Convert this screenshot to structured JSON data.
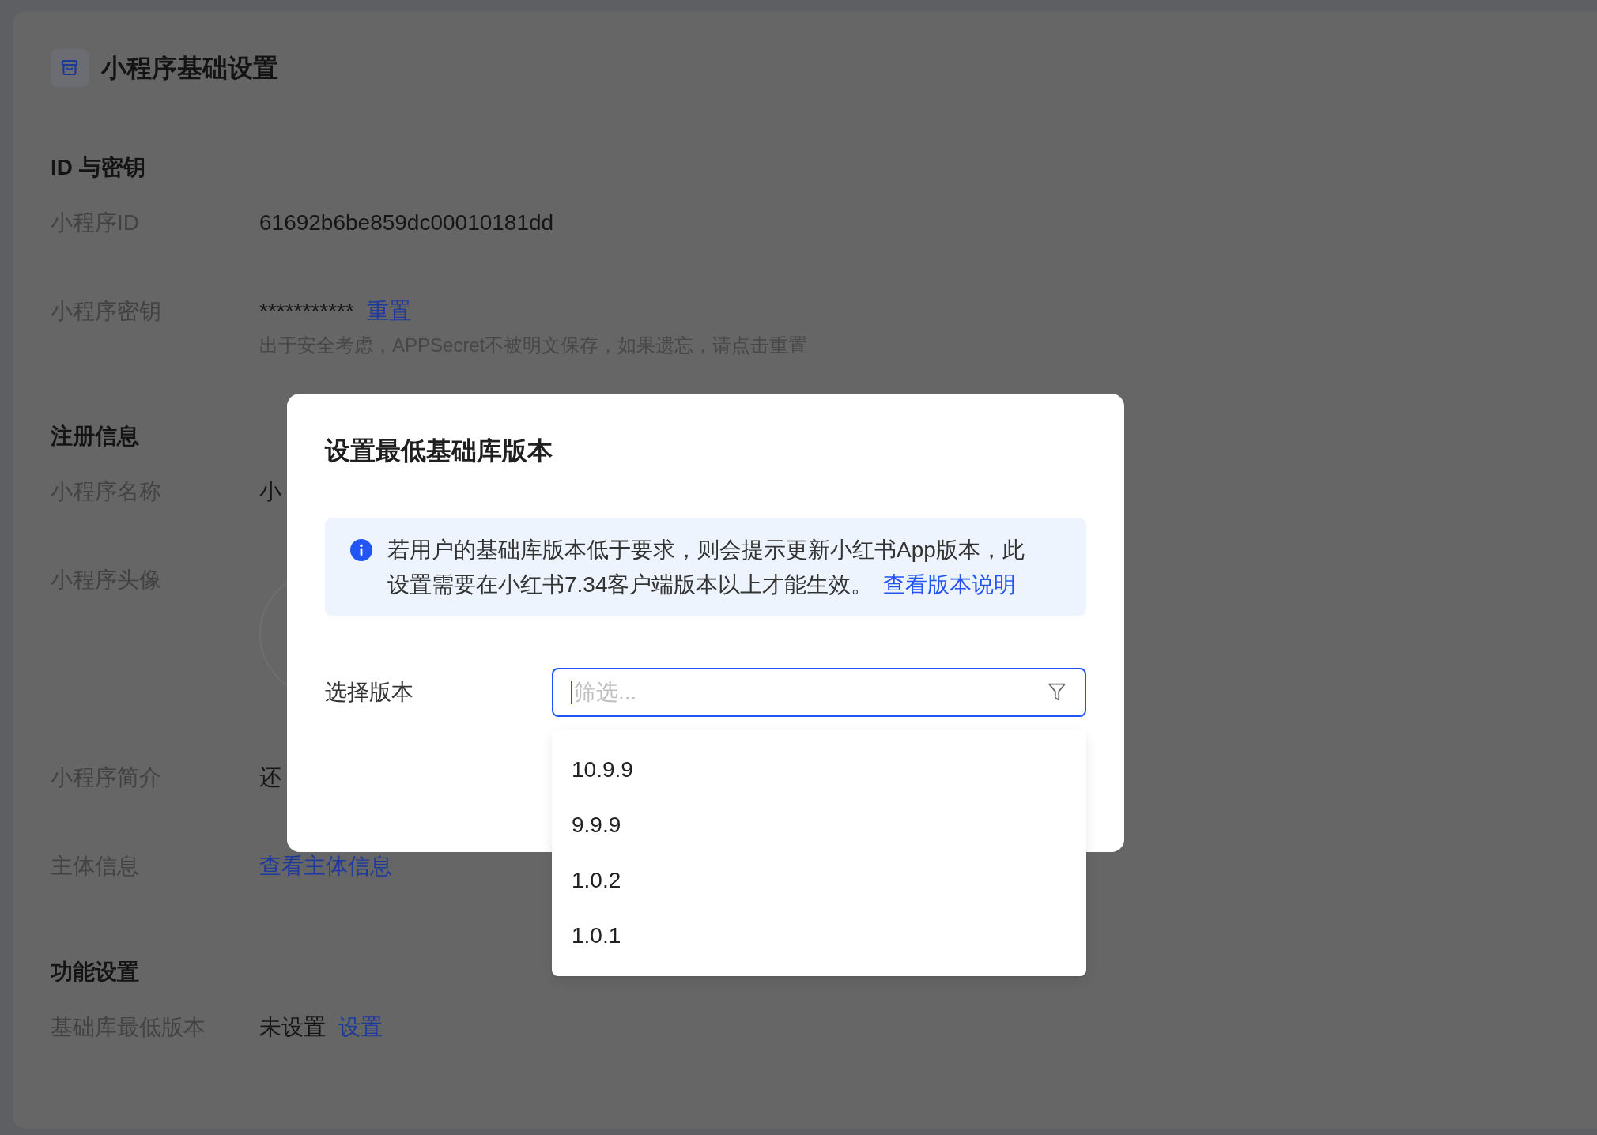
{
  "page": {
    "title": "小程序基础设置"
  },
  "sections": [
    {
      "heading": "ID 与密钥",
      "rows": [
        {
          "kind": "text",
          "label": "小程序ID",
          "value": "61692b6be859dc00010181dd"
        },
        {
          "kind": "text",
          "label": "小程序密钥",
          "value": "***********",
          "link": "重置",
          "hint": "出于安全考虑，APPSecret不被明文保存，如果遗忘，请点击重置"
        }
      ]
    },
    {
      "heading": "注册信息",
      "rows": [
        {
          "kind": "text",
          "label": "小程序名称",
          "value": "小"
        },
        {
          "kind": "avatar",
          "label": "小程序头像"
        },
        {
          "kind": "text",
          "label": "小程序简介",
          "value": "还"
        },
        {
          "kind": "text",
          "label": "主体信息",
          "link": "查看主体信息"
        }
      ]
    },
    {
      "heading": "功能设置",
      "rows": [
        {
          "kind": "text",
          "label": "基础库最低版本",
          "value": "未设置",
          "link": "设置"
        }
      ]
    }
  ],
  "dialog": {
    "title": "设置最低基础库版本",
    "notice": {
      "text": "若用户的基础库版本低于要求，则会提示更新小红书App版本，此设置需要在小红书7.34客户端版本以上才能生效。",
      "link": "查看版本说明"
    },
    "field": {
      "label": "选择版本",
      "placeholder": "筛选...",
      "focused": true,
      "expanded": true,
      "options": [
        {
          "label": "10.9.9",
          "selected": false
        },
        {
          "label": "9.9.9",
          "selected": false
        },
        {
          "label": "1.0.2",
          "selected": false
        },
        {
          "label": "1.0.1",
          "selected": false
        }
      ]
    }
  }
}
